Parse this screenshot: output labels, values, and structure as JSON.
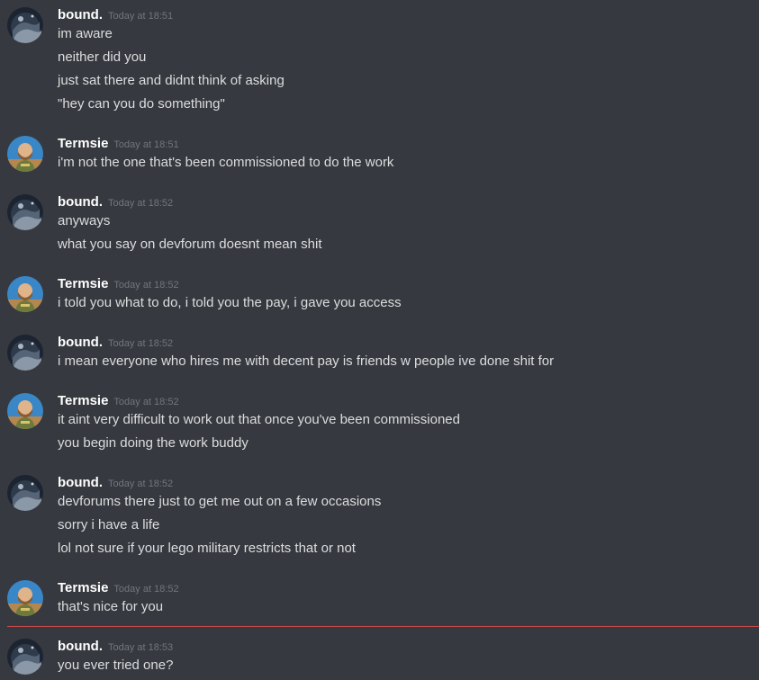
{
  "users": {
    "bound": {
      "name": "bound.",
      "avatar_icon": "dark-planet-avatar-icon"
    },
    "termsie": {
      "name": "Termsie",
      "avatar_icon": "bearded-man-avatar-icon"
    }
  },
  "colors": {
    "background": "#36393f",
    "username": "#ffffff",
    "timestamp": "#72767d",
    "message_text": "#dcddde",
    "new_messages_divider": "#c84b4b"
  },
  "messages": [
    {
      "author": "bound.",
      "time": "Today at 18:51",
      "lines": [
        "im aware",
        "neither did you",
        "just sat there and didnt think of asking",
        "\"hey can you do something\""
      ]
    },
    {
      "author": "Termsie",
      "time": "Today at 18:51",
      "lines": [
        "i'm not the one that's been commissioned to do the work"
      ]
    },
    {
      "author": "bound.",
      "time": "Today at 18:52",
      "lines": [
        "anyways",
        "what you say on devforum doesnt mean shit"
      ]
    },
    {
      "author": "Termsie",
      "time": "Today at 18:52",
      "lines": [
        "i told you what to do, i told you the pay, i gave you access"
      ]
    },
    {
      "author": "bound.",
      "time": "Today at 18:52",
      "lines": [
        "i mean everyone who hires me with decent pay is friends w people ive done shit for"
      ]
    },
    {
      "author": "Termsie",
      "time": "Today at 18:52",
      "lines": [
        "it aint very difficult to work out that once you've been commissioned",
        "you begin doing the work buddy"
      ]
    },
    {
      "author": "bound.",
      "time": "Today at 18:52",
      "lines": [
        "devforums there just to get me out on a few occasions",
        "sorry i have a life",
        "lol not sure if your lego military restricts that or not"
      ]
    },
    {
      "author": "Termsie",
      "time": "Today at 18:52",
      "lines": [
        "that's nice for you"
      ]
    },
    {
      "author": "bound.",
      "time": "Today at 18:53",
      "lines": [
        "you ever tried one?"
      ]
    }
  ]
}
